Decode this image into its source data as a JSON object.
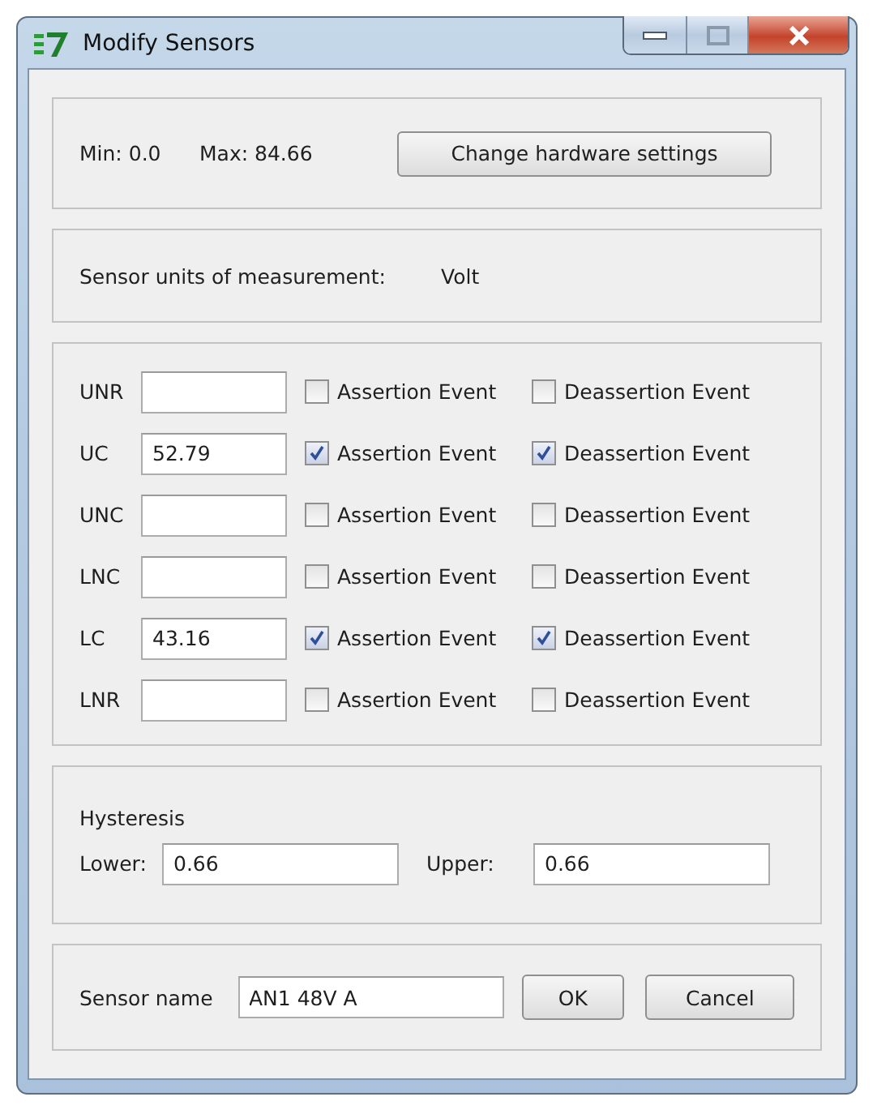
{
  "window": {
    "title": "Modify Sensors"
  },
  "range": {
    "min_label": "Min: 0.0",
    "max_label": "Max: 84.66",
    "button": "Change hardware settings"
  },
  "units": {
    "label": "Sensor units of measurement:",
    "value": "Volt"
  },
  "thresholds": [
    {
      "name": "UNR",
      "assertion": {
        "label": "Assertion Event",
        "checked": false
      },
      "deassertion": {
        "label": "Deassertion Event",
        "checked": false
      }
    },
    {
      "name": "UC",
      "value": "52.79",
      "assertion": {
        "label": "Assertion Event",
        "checked": true
      },
      "deassertion": {
        "label": "Deassertion Event",
        "checked": true
      }
    },
    {
      "name": "UNC",
      "assertion": {
        "label": "Assertion Event",
        "checked": false
      },
      "deassertion": {
        "label": "Deassertion Event",
        "checked": false
      }
    },
    {
      "name": "LNC",
      "assertion": {
        "label": "Assertion Event",
        "checked": false
      },
      "deassertion": {
        "label": "Deassertion Event",
        "checked": false
      }
    },
    {
      "name": "LC",
      "value": "43.16",
      "assertion": {
        "label": "Assertion Event",
        "checked": true
      },
      "deassertion": {
        "label": "Deassertion Event",
        "checked": true
      }
    },
    {
      "name": "LNR",
      "assertion": {
        "label": "Assertion Event",
        "checked": false
      },
      "deassertion": {
        "label": "Deassertion Event",
        "checked": false
      }
    }
  ],
  "hysteresis": {
    "title": "Hysteresis",
    "lower": {
      "label": "Lower:",
      "value": "0.66"
    },
    "upper": {
      "label": "Upper:",
      "value": "0.66"
    }
  },
  "sensor_name": {
    "label": "Sensor name",
    "value": "AN1 48V A"
  },
  "buttons": [
    "OK",
    "Cancel"
  ]
}
